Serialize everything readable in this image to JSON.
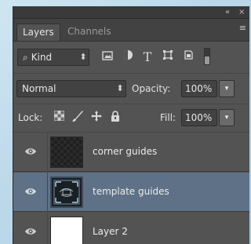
{
  "panel": {
    "titlebar": {
      "collapse_glyph": "«",
      "close_glyph": "×"
    },
    "tabs": [
      {
        "label": "Layers",
        "active": true
      },
      {
        "label": "Channels",
        "active": false
      }
    ],
    "menu_glyph": "≡"
  },
  "filter": {
    "search_glyph": "⌕",
    "kind_label": "Kind",
    "stepper_glyph": "⬍",
    "filter_icons": [
      "image-filter-icon",
      "adjustment-filter-icon",
      "type-filter-icon",
      "shape-filter-icon",
      "smart-object-filter-icon",
      "filter-toggle-icon"
    ],
    "type_glyph": "T"
  },
  "blend": {
    "mode": "Normal",
    "opacity_label": "Opacity:",
    "opacity_value": "100%",
    "dropdown_glyph": "▾"
  },
  "lock": {
    "label": "Lock:",
    "fill_label": "Fill:",
    "fill_value": "100%",
    "lock_icons": [
      "lock-transparent-pixels-icon",
      "lock-image-pixels-icon",
      "lock-position-icon",
      "lock-all-icon"
    ]
  },
  "layers": [
    {
      "name": "corner guides",
      "thumbnail": "transparent",
      "visible": true,
      "selected": false
    },
    {
      "name": "template guides",
      "thumbnail": "template",
      "visible": true,
      "selected": true
    },
    {
      "name": "Layer 2",
      "thumbnail": "white",
      "visible": true,
      "selected": false
    }
  ],
  "colors": {
    "selected_row": "#5e7187",
    "panel_bg": "#535353"
  }
}
